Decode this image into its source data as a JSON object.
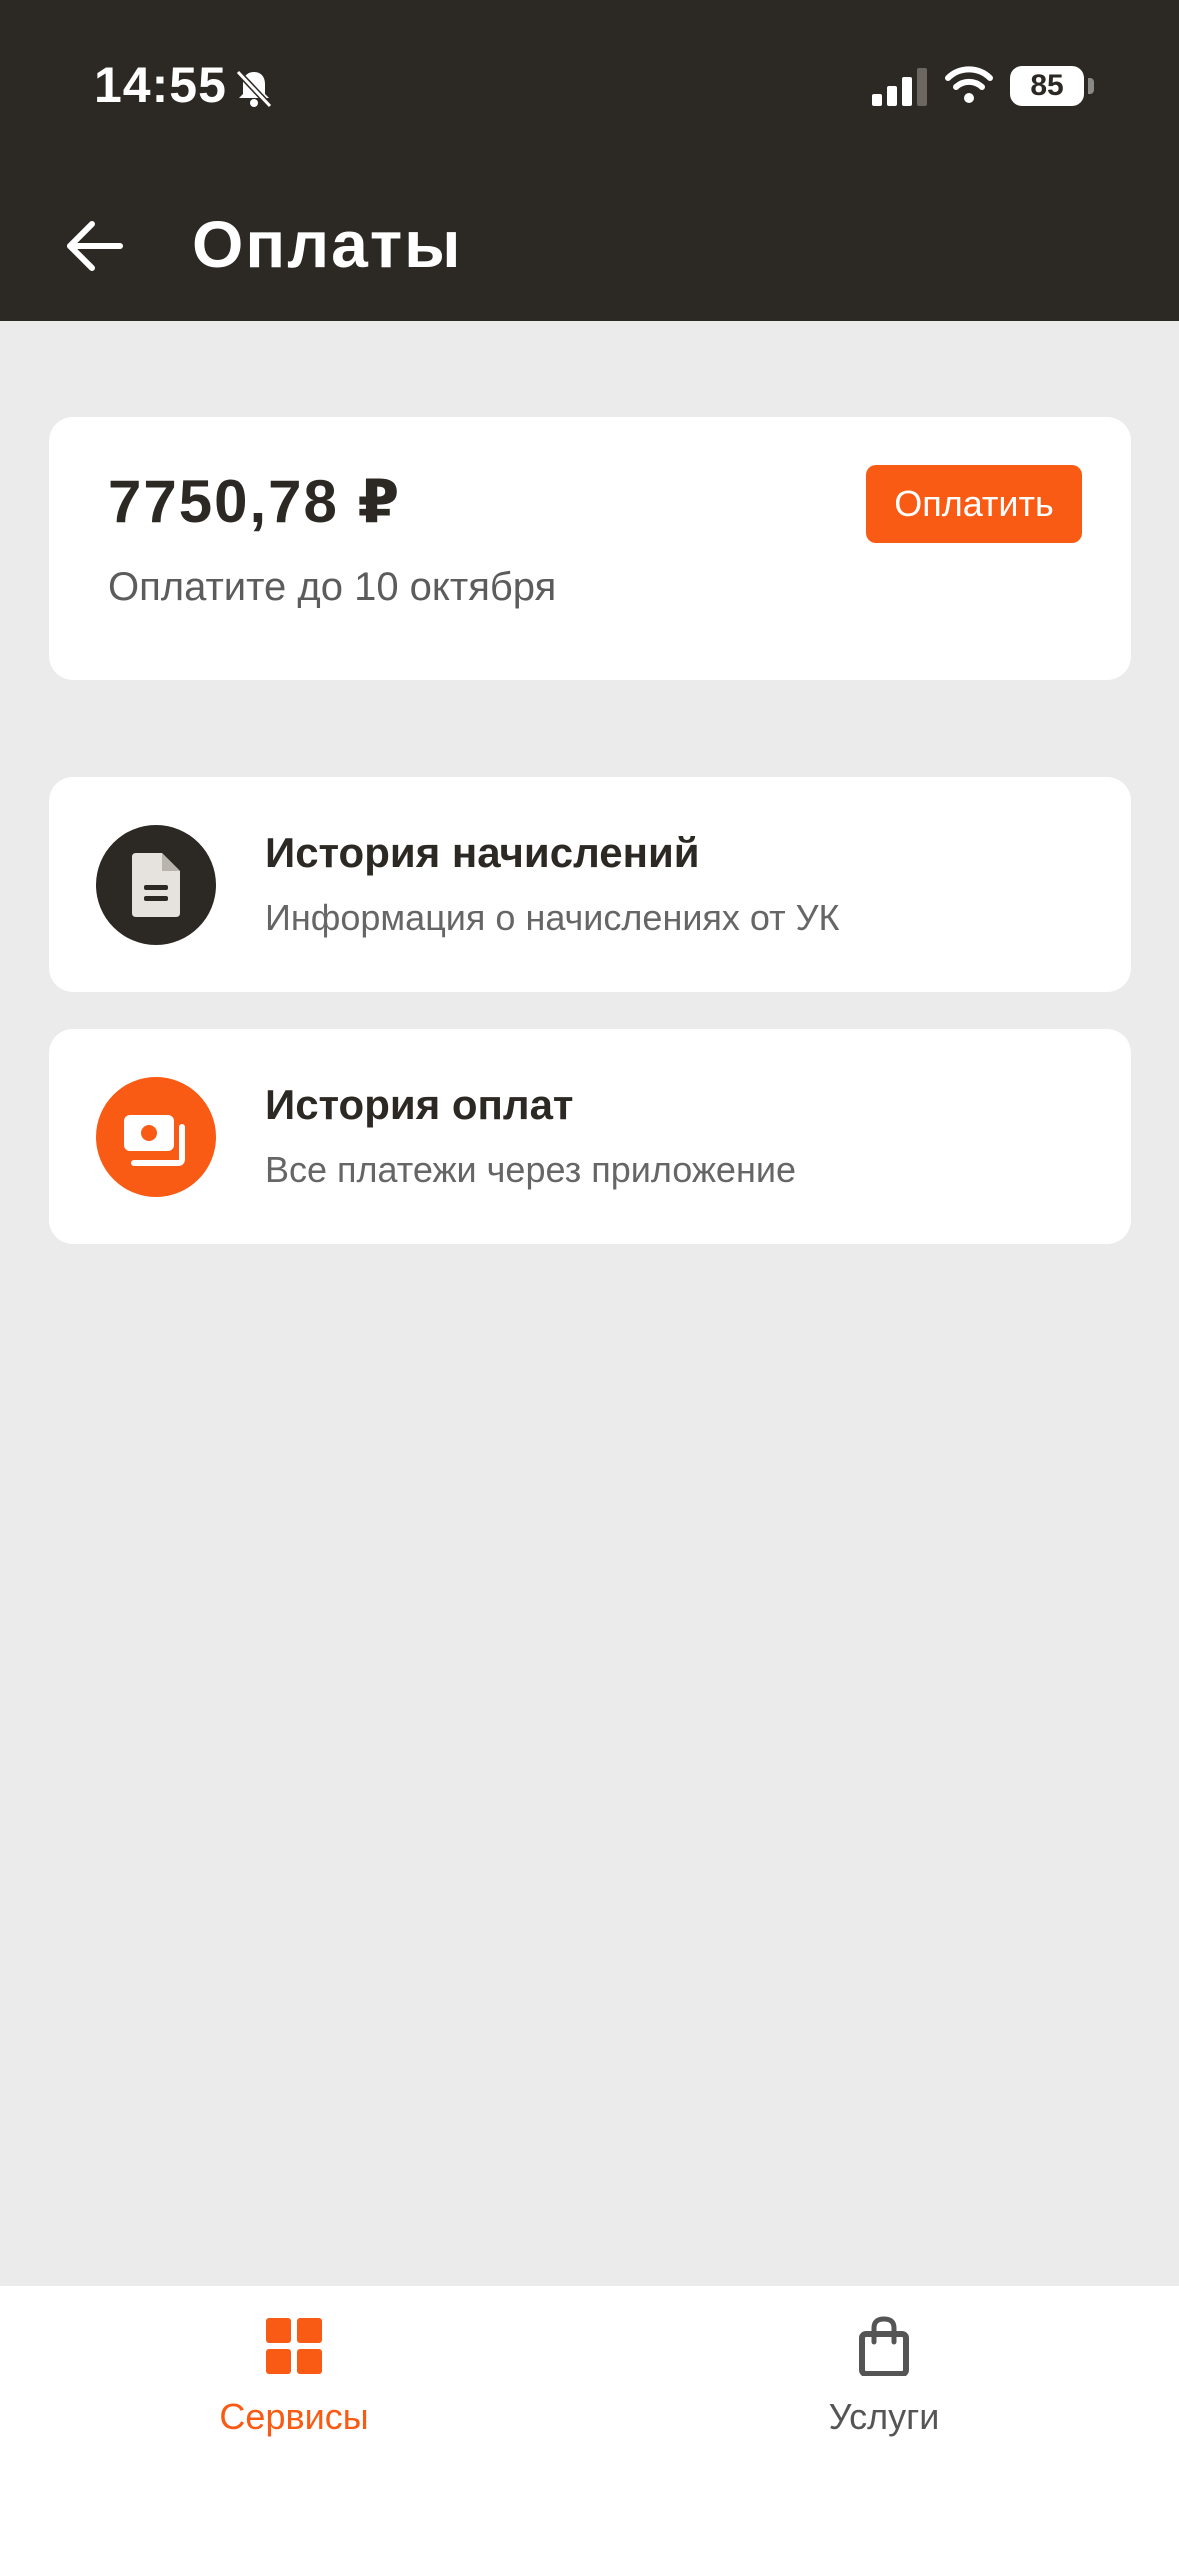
{
  "status_bar": {
    "time": "14:55",
    "battery": "85"
  },
  "header": {
    "title": "Оплаты"
  },
  "payment": {
    "amount": "7750,78 ₽",
    "due_text": "Оплатите до 10 октября",
    "pay_label": "Оплатить"
  },
  "menu": [
    {
      "title": "История начислений",
      "subtitle": "Информация о начислениях от УК",
      "icon": "document-icon"
    },
    {
      "title": "История оплат",
      "subtitle": "Все платежи через приложение",
      "icon": "cash-icon"
    }
  ],
  "bottom_nav": [
    {
      "label": "Сервисы",
      "icon": "grid-icon",
      "active": true
    },
    {
      "label": "Услуги",
      "icon": "bag-icon",
      "active": false
    }
  ],
  "colors": {
    "header_bg": "#2c2924",
    "accent": "#fa5b14",
    "background": "#ecebec"
  }
}
